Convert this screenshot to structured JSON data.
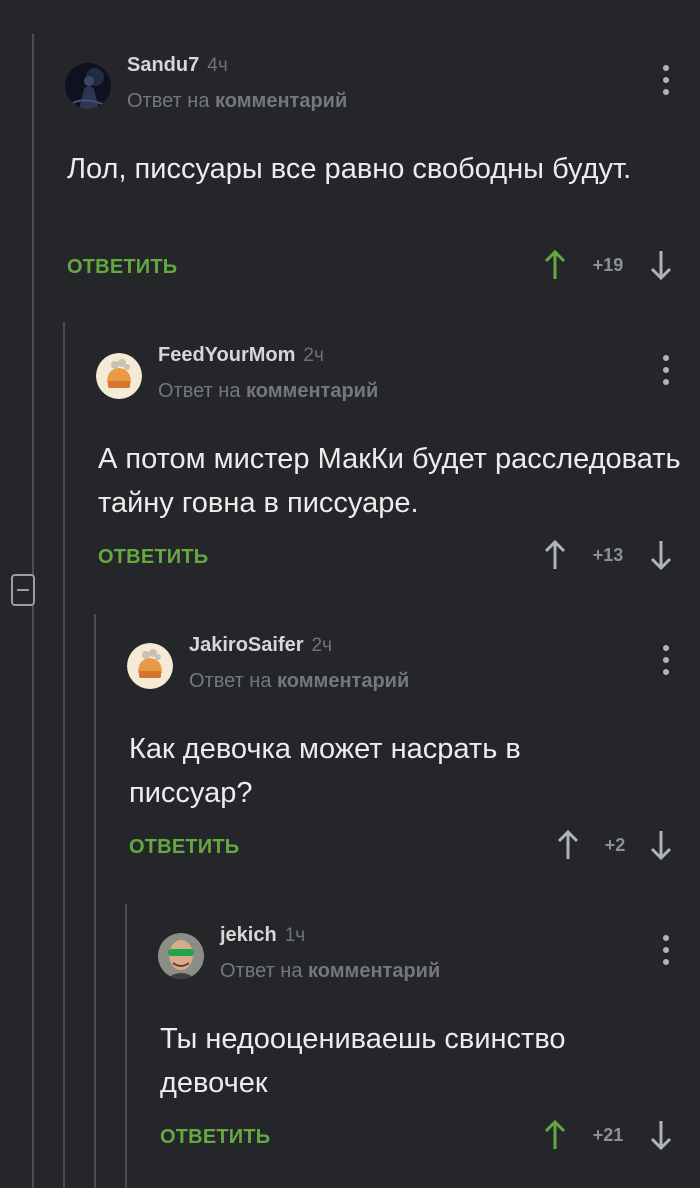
{
  "reply_prefix": "Ответ на",
  "reply_target": "комментарий",
  "reply_button": "ОТВЕТИТЬ",
  "colors": {
    "background": "#24262a",
    "reply_button": "#65a842",
    "upvote_active": "#65a842",
    "thread_line": "#4a4d52"
  },
  "comments": [
    {
      "author": "Sandu7",
      "time": "4ч",
      "text": "Лол, писсуары все равно свободны будут.",
      "score": "+19",
      "upvoted": true,
      "avatar": "dark-figure-avatar"
    },
    {
      "author": "FeedYourMom",
      "time": "2ч",
      "text": "А потом мистер МакКи будет расследовать тайну говна в писсуаре.",
      "score": "+13",
      "upvoted": false,
      "avatar": "default-avatar"
    },
    {
      "author": "JakiroSaifer",
      "time": "2ч",
      "text": "Как девочка может насрать в писсуар?",
      "score": "+2",
      "upvoted": false,
      "avatar": "default-avatar"
    },
    {
      "author": "jekich",
      "time": "1ч",
      "text": "Ты недооцениваешь свинство девочек",
      "score": "+21",
      "upvoted": true,
      "avatar": "man-in-green-glasses-avatar"
    }
  ]
}
